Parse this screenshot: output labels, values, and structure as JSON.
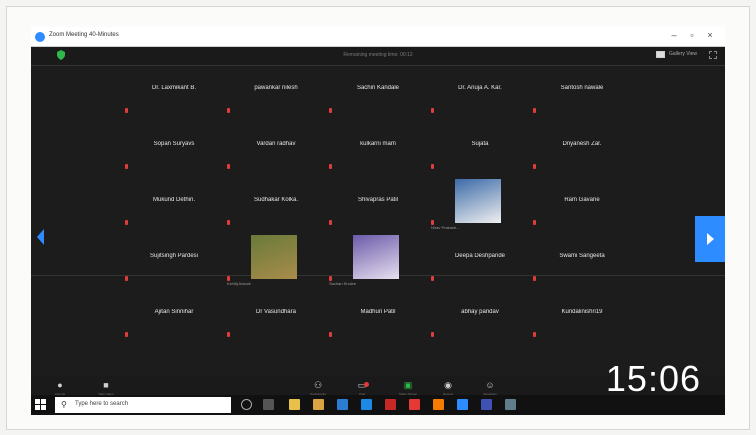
{
  "window": {
    "title": "Zoom Meeting 40-Minutes"
  },
  "meeting": {
    "center_text": "Remaining meeting time: 00:12",
    "view_label": "Gallery View"
  },
  "participants": [
    {
      "name": "Dr. Laxmikant B.",
      "row": 0,
      "col": 0
    },
    {
      "name": "pawankar nilesh",
      "row": 0,
      "col": 1
    },
    {
      "name": "Sachin Kandale",
      "row": 0,
      "col": 2
    },
    {
      "name": "Dr. Anuja A. Kar.",
      "row": 0,
      "col": 3
    },
    {
      "name": "Santosh nawale",
      "row": 0,
      "col": 4
    },
    {
      "name": "Sopan Suryavs",
      "row": 1,
      "col": 0
    },
    {
      "name": "Vardan radhav",
      "row": 1,
      "col": 1
    },
    {
      "name": "kulkarni mam",
      "row": 1,
      "col": 2
    },
    {
      "name": "Sujata",
      "row": 1,
      "col": 3
    },
    {
      "name": "Dnyanesh Zar.",
      "row": 1,
      "col": 4
    },
    {
      "name": "Mukund Dethin.",
      "row": 2,
      "col": 0
    },
    {
      "name": "Sudhakar Kolka.",
      "row": 2,
      "col": 1
    },
    {
      "name": "Shivapras Patil",
      "row": 2,
      "col": 2
    },
    {
      "name": "",
      "row": 2,
      "col": 3,
      "photo": true,
      "photo_label": "Nirav Prakash..."
    },
    {
      "name": "Ram Gavane",
      "row": 2,
      "col": 4
    },
    {
      "name": "Sujitsingh Pardesi",
      "row": 3,
      "col": 0
    },
    {
      "name": "",
      "row": 3,
      "col": 1,
      "photo": true,
      "photo_label": "Kshitij Adsule"
    },
    {
      "name": "",
      "row": 3,
      "col": 2,
      "photo": true,
      "photo_label": "Sachan Khulee"
    },
    {
      "name": "Deepa Deshpande",
      "row": 3,
      "col": 3
    },
    {
      "name": "Swami Sangeeta",
      "row": 3,
      "col": 4
    },
    {
      "name": "Ajitan Sinnihar",
      "row": 4,
      "col": 0
    },
    {
      "name": "Dr Vasundhara",
      "row": 4,
      "col": 1
    },
    {
      "name": "Madhuri Patil",
      "row": 4,
      "col": 2
    },
    {
      "name": "abhay pandav",
      "row": 4,
      "col": 3
    },
    {
      "name": "Kundalinishri19",
      "row": 4,
      "col": 4
    }
  ],
  "toolbar": {
    "mute": {
      "icon": "microphone-icon",
      "label": "Unmute"
    },
    "video": {
      "icon": "video-icon",
      "label": "Start Video"
    },
    "participants": {
      "icon": "participants-icon",
      "label": "Participants"
    },
    "chat": {
      "icon": "chat-icon",
      "label": "Chat"
    },
    "share": {
      "icon": "share-screen-icon",
      "label": "Share Screen"
    },
    "record": {
      "icon": "record-icon",
      "label": "Record"
    },
    "reactions": {
      "icon": "reactions-icon",
      "label": "Reactions"
    }
  },
  "clock": "15:06",
  "taskbar": {
    "search_placeholder": "Type here to search"
  },
  "colors": {
    "accent": "#2d8cff",
    "background": "#1c1c1c",
    "mic_muted": "#e23b3b"
  }
}
